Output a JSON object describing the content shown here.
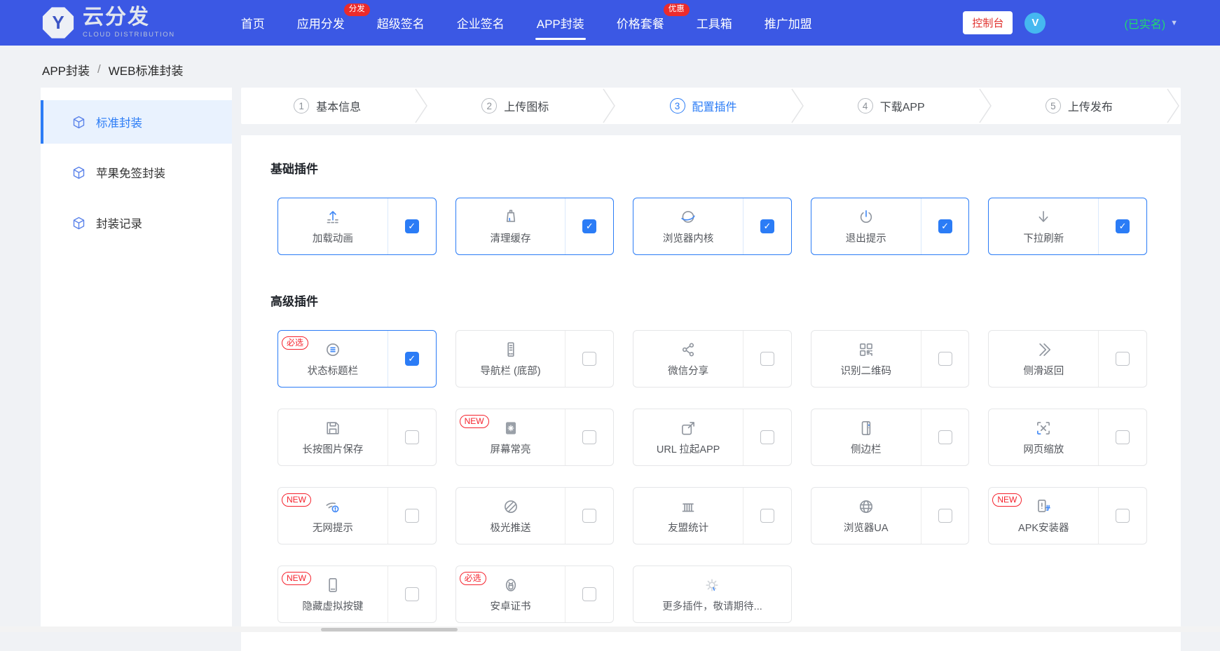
{
  "colors": {
    "header_bg": "#3b58e4",
    "accent": "#2b7cf6",
    "red": "#ec2b2b",
    "green": "#21d96f",
    "avatar": "#45b8f0"
  },
  "header": {
    "logo": {
      "badge_letter": "Y",
      "title": "云分发",
      "subtitle": "CLOUD DISTRIBUTION"
    },
    "nav": [
      {
        "id": "home",
        "label": "首页"
      },
      {
        "id": "app-distribution",
        "label": "应用分发",
        "badge": "分发"
      },
      {
        "id": "super-sign",
        "label": "超级签名"
      },
      {
        "id": "enterprise-sign",
        "label": "企业签名"
      },
      {
        "id": "app-packaging",
        "label": "APP封装",
        "active": true
      },
      {
        "id": "pricing",
        "label": "价格套餐",
        "badge": "优惠"
      },
      {
        "id": "toolbox",
        "label": "工具箱"
      },
      {
        "id": "promotion",
        "label": "推广加盟"
      }
    ],
    "console_button": "控制台",
    "avatar_letter": "V",
    "account_status": "(已实名)"
  },
  "breadcrumb": {
    "items": [
      "APP封装",
      "WEB标准封装"
    ],
    "separator": "/"
  },
  "sidebar": {
    "items": [
      {
        "id": "standard-packaging",
        "label": "标准封装",
        "active": true
      },
      {
        "id": "apple-signfree-packaging",
        "label": "苹果免签封装"
      },
      {
        "id": "packaging-records",
        "label": "封装记录"
      }
    ]
  },
  "steps": [
    {
      "id": "basic-info",
      "num": "1",
      "label": "基本信息"
    },
    {
      "id": "upload-icon",
      "num": "2",
      "label": "上传图标"
    },
    {
      "id": "configure-plugins",
      "num": "3",
      "label": "配置插件",
      "active": true
    },
    {
      "id": "download-app",
      "num": "4",
      "label": "下载APP"
    },
    {
      "id": "upload-publish",
      "num": "5",
      "label": "上传发布"
    }
  ],
  "plugins": {
    "basic_title": "基础插件",
    "advanced_title": "高级插件",
    "basic": [
      {
        "id": "loading-animation",
        "label": "加载动画",
        "checked": true,
        "selected": true
      },
      {
        "id": "clear-cache",
        "label": "清理缓存",
        "checked": true,
        "selected": true
      },
      {
        "id": "browser-core",
        "label": "浏览器内核",
        "checked": true,
        "selected": true
      },
      {
        "id": "exit-prompt",
        "label": "退出提示",
        "checked": true,
        "selected": true
      },
      {
        "id": "pull-refresh",
        "label": "下拉刷新",
        "checked": true,
        "selected": true
      }
    ],
    "advanced": [
      {
        "id": "status-titlebar",
        "label": "状态标题栏",
        "badge": "必选",
        "checked": true,
        "selected": true
      },
      {
        "id": "bottom-navbar",
        "label": "导航栏 (底部)",
        "checked": false
      },
      {
        "id": "wechat-share",
        "label": "微信分享",
        "checked": false
      },
      {
        "id": "qr-scan",
        "label": "识别二维码",
        "checked": false
      },
      {
        "id": "swipe-back",
        "label": "侧滑返回",
        "checked": false
      },
      {
        "id": "save-image-longpress",
        "label": "长按图片保存",
        "checked": false
      },
      {
        "id": "screen-always-on",
        "label": "屏幕常亮",
        "badge": "NEW",
        "checked": false
      },
      {
        "id": "url-launch-app",
        "label": "URL 拉起APP",
        "checked": false
      },
      {
        "id": "sidebar",
        "label": "侧边栏",
        "checked": false
      },
      {
        "id": "page-zoom",
        "label": "网页缩放",
        "checked": false
      },
      {
        "id": "no-network-tip",
        "label": "无网提示",
        "badge": "NEW",
        "checked": false
      },
      {
        "id": "jpush",
        "label": "极光推送",
        "checked": false
      },
      {
        "id": "umeng-stats",
        "label": "友盟统计",
        "checked": false
      },
      {
        "id": "browser-ua",
        "label": "浏览器UA",
        "checked": false
      },
      {
        "id": "apk-installer",
        "label": "APK安装器",
        "badge": "NEW",
        "checked": false
      },
      {
        "id": "hide-virtual-keys",
        "label": "隐藏虚拟按键",
        "badge": "NEW",
        "checked": false
      },
      {
        "id": "android-cert",
        "label": "安卓证书",
        "badge": "必选",
        "checked": false
      },
      {
        "id": "more-plugins",
        "label": "更多插件，敬请期待...",
        "more": true
      }
    ]
  }
}
